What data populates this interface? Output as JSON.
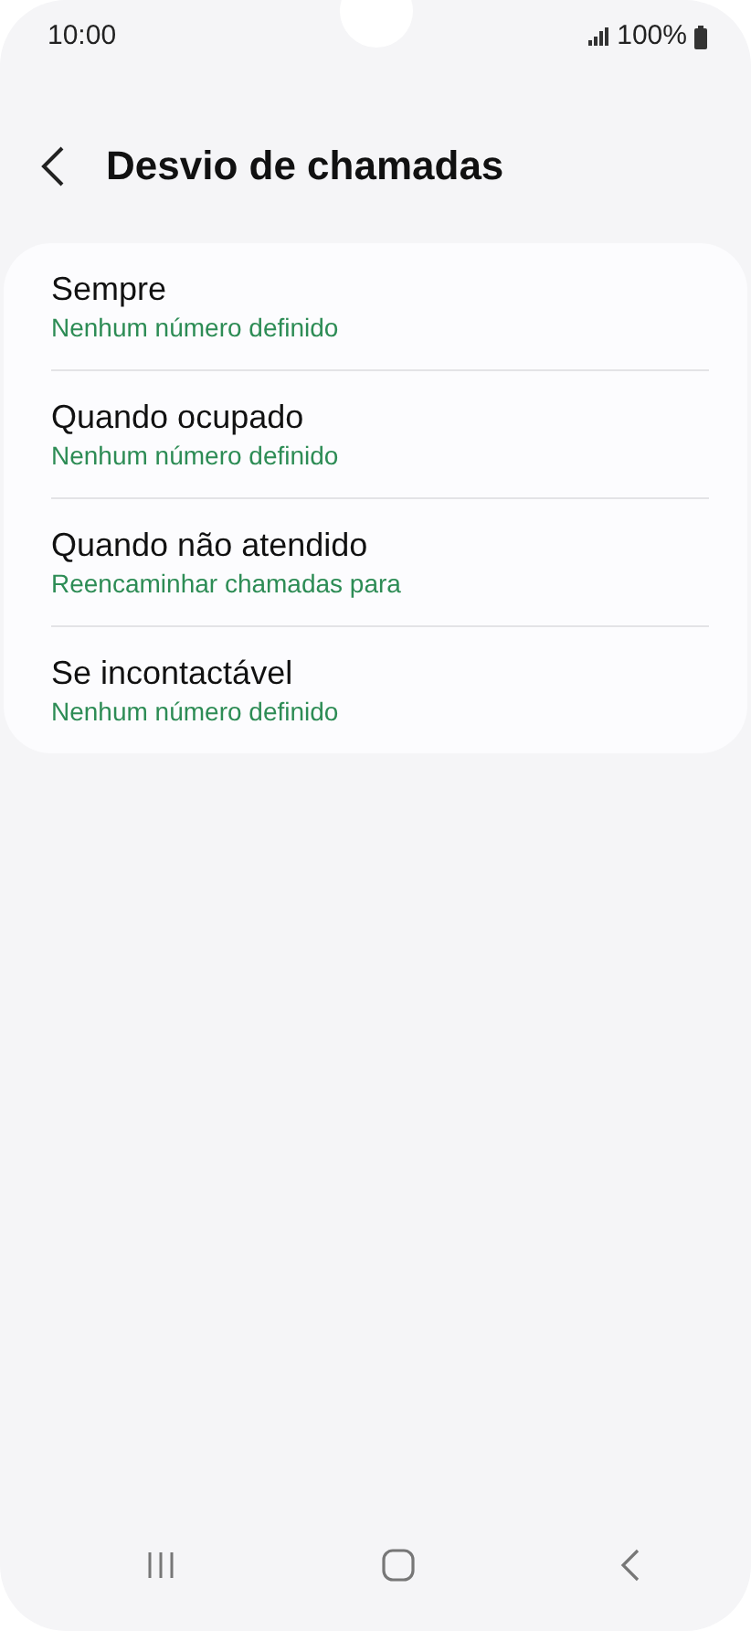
{
  "status_bar": {
    "time": "10:00",
    "battery": "100%"
  },
  "header": {
    "title": "Desvio de chamadas"
  },
  "items": [
    {
      "title": "Sempre",
      "subtitle": "Nenhum número definido"
    },
    {
      "title": "Quando ocupado",
      "subtitle": "Nenhum número definido"
    },
    {
      "title": "Quando não atendido",
      "subtitle": "Reencaminhar chamadas para"
    },
    {
      "title": "Se incontactável",
      "subtitle": "Nenhum número definido"
    }
  ]
}
